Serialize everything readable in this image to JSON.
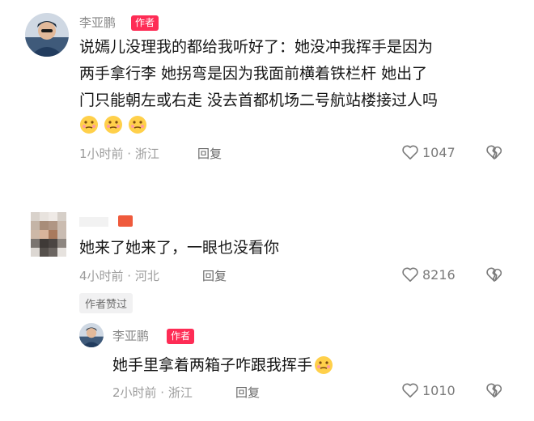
{
  "comments": [
    {
      "author": "李亚鹏",
      "badge": "作者",
      "line1": "说嫣儿没理我的都给我听好了：她没冲我挥手是因为",
      "line2": "两手拿行李  她拐弯是因为我面前横着铁栏杆  她出了",
      "line3": "门只能朝左或右走  没去首都机场二号航站楼接过人吗",
      "time_location": "1小时前 · 浙江",
      "reply": "回复",
      "likes": "1047"
    },
    {
      "text": "她来了她来了，一眼也没看你",
      "time_location": "4小时前 · 河北",
      "reply": "回复",
      "likes": "8216",
      "author_liked_tag": "作者赞过"
    }
  ],
  "sub_reply": {
    "author": "李亚鹏",
    "badge": "作者",
    "text": "她手里拿着两箱子咋跟我挥手",
    "time_location": "2小时前 · 浙江",
    "reply": "回复",
    "likes": "1010"
  },
  "colors": {
    "badge": "#fe2c55",
    "meta": "#9c9c9c",
    "text": "#161616"
  }
}
